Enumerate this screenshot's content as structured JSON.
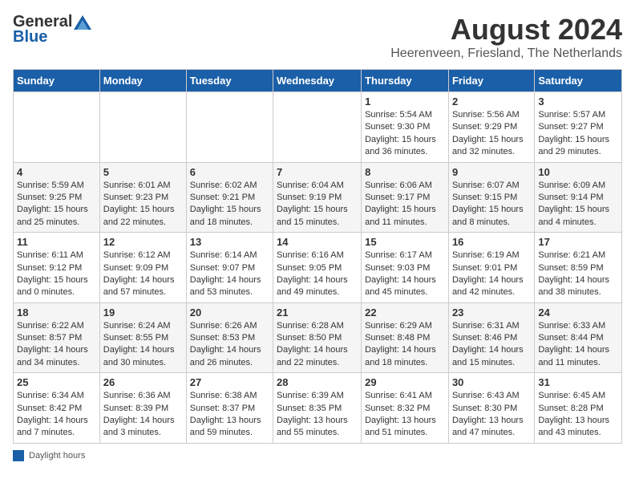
{
  "header": {
    "logo_general": "General",
    "logo_blue": "Blue",
    "month_title": "August 2024",
    "location": "Heerenveen, Friesland, The Netherlands"
  },
  "weekdays": [
    "Sunday",
    "Monday",
    "Tuesday",
    "Wednesday",
    "Thursday",
    "Friday",
    "Saturday"
  ],
  "legend_label": "Daylight hours",
  "weeks": [
    [
      {
        "day": "",
        "info": ""
      },
      {
        "day": "",
        "info": ""
      },
      {
        "day": "",
        "info": ""
      },
      {
        "day": "",
        "info": ""
      },
      {
        "day": "1",
        "info": "Sunrise: 5:54 AM\nSunset: 9:30 PM\nDaylight: 15 hours\nand 36 minutes."
      },
      {
        "day": "2",
        "info": "Sunrise: 5:56 AM\nSunset: 9:29 PM\nDaylight: 15 hours\nand 32 minutes."
      },
      {
        "day": "3",
        "info": "Sunrise: 5:57 AM\nSunset: 9:27 PM\nDaylight: 15 hours\nand 29 minutes."
      }
    ],
    [
      {
        "day": "4",
        "info": "Sunrise: 5:59 AM\nSunset: 9:25 PM\nDaylight: 15 hours\nand 25 minutes."
      },
      {
        "day": "5",
        "info": "Sunrise: 6:01 AM\nSunset: 9:23 PM\nDaylight: 15 hours\nand 22 minutes."
      },
      {
        "day": "6",
        "info": "Sunrise: 6:02 AM\nSunset: 9:21 PM\nDaylight: 15 hours\nand 18 minutes."
      },
      {
        "day": "7",
        "info": "Sunrise: 6:04 AM\nSunset: 9:19 PM\nDaylight: 15 hours\nand 15 minutes."
      },
      {
        "day": "8",
        "info": "Sunrise: 6:06 AM\nSunset: 9:17 PM\nDaylight: 15 hours\nand 11 minutes."
      },
      {
        "day": "9",
        "info": "Sunrise: 6:07 AM\nSunset: 9:15 PM\nDaylight: 15 hours\nand 8 minutes."
      },
      {
        "day": "10",
        "info": "Sunrise: 6:09 AM\nSunset: 9:14 PM\nDaylight: 15 hours\nand 4 minutes."
      }
    ],
    [
      {
        "day": "11",
        "info": "Sunrise: 6:11 AM\nSunset: 9:12 PM\nDaylight: 15 hours\nand 0 minutes."
      },
      {
        "day": "12",
        "info": "Sunrise: 6:12 AM\nSunset: 9:09 PM\nDaylight: 14 hours\nand 57 minutes."
      },
      {
        "day": "13",
        "info": "Sunrise: 6:14 AM\nSunset: 9:07 PM\nDaylight: 14 hours\nand 53 minutes."
      },
      {
        "day": "14",
        "info": "Sunrise: 6:16 AM\nSunset: 9:05 PM\nDaylight: 14 hours\nand 49 minutes."
      },
      {
        "day": "15",
        "info": "Sunrise: 6:17 AM\nSunset: 9:03 PM\nDaylight: 14 hours\nand 45 minutes."
      },
      {
        "day": "16",
        "info": "Sunrise: 6:19 AM\nSunset: 9:01 PM\nDaylight: 14 hours\nand 42 minutes."
      },
      {
        "day": "17",
        "info": "Sunrise: 6:21 AM\nSunset: 8:59 PM\nDaylight: 14 hours\nand 38 minutes."
      }
    ],
    [
      {
        "day": "18",
        "info": "Sunrise: 6:22 AM\nSunset: 8:57 PM\nDaylight: 14 hours\nand 34 minutes."
      },
      {
        "day": "19",
        "info": "Sunrise: 6:24 AM\nSunset: 8:55 PM\nDaylight: 14 hours\nand 30 minutes."
      },
      {
        "day": "20",
        "info": "Sunrise: 6:26 AM\nSunset: 8:53 PM\nDaylight: 14 hours\nand 26 minutes."
      },
      {
        "day": "21",
        "info": "Sunrise: 6:28 AM\nSunset: 8:50 PM\nDaylight: 14 hours\nand 22 minutes."
      },
      {
        "day": "22",
        "info": "Sunrise: 6:29 AM\nSunset: 8:48 PM\nDaylight: 14 hours\nand 18 minutes."
      },
      {
        "day": "23",
        "info": "Sunrise: 6:31 AM\nSunset: 8:46 PM\nDaylight: 14 hours\nand 15 minutes."
      },
      {
        "day": "24",
        "info": "Sunrise: 6:33 AM\nSunset: 8:44 PM\nDaylight: 14 hours\nand 11 minutes."
      }
    ],
    [
      {
        "day": "25",
        "info": "Sunrise: 6:34 AM\nSunset: 8:42 PM\nDaylight: 14 hours\nand 7 minutes."
      },
      {
        "day": "26",
        "info": "Sunrise: 6:36 AM\nSunset: 8:39 PM\nDaylight: 14 hours\nand 3 minutes."
      },
      {
        "day": "27",
        "info": "Sunrise: 6:38 AM\nSunset: 8:37 PM\nDaylight: 13 hours\nand 59 minutes."
      },
      {
        "day": "28",
        "info": "Sunrise: 6:39 AM\nSunset: 8:35 PM\nDaylight: 13 hours\nand 55 minutes."
      },
      {
        "day": "29",
        "info": "Sunrise: 6:41 AM\nSunset: 8:32 PM\nDaylight: 13 hours\nand 51 minutes."
      },
      {
        "day": "30",
        "info": "Sunrise: 6:43 AM\nSunset: 8:30 PM\nDaylight: 13 hours\nand 47 minutes."
      },
      {
        "day": "31",
        "info": "Sunrise: 6:45 AM\nSunset: 8:28 PM\nDaylight: 13 hours\nand 43 minutes."
      }
    ]
  ]
}
